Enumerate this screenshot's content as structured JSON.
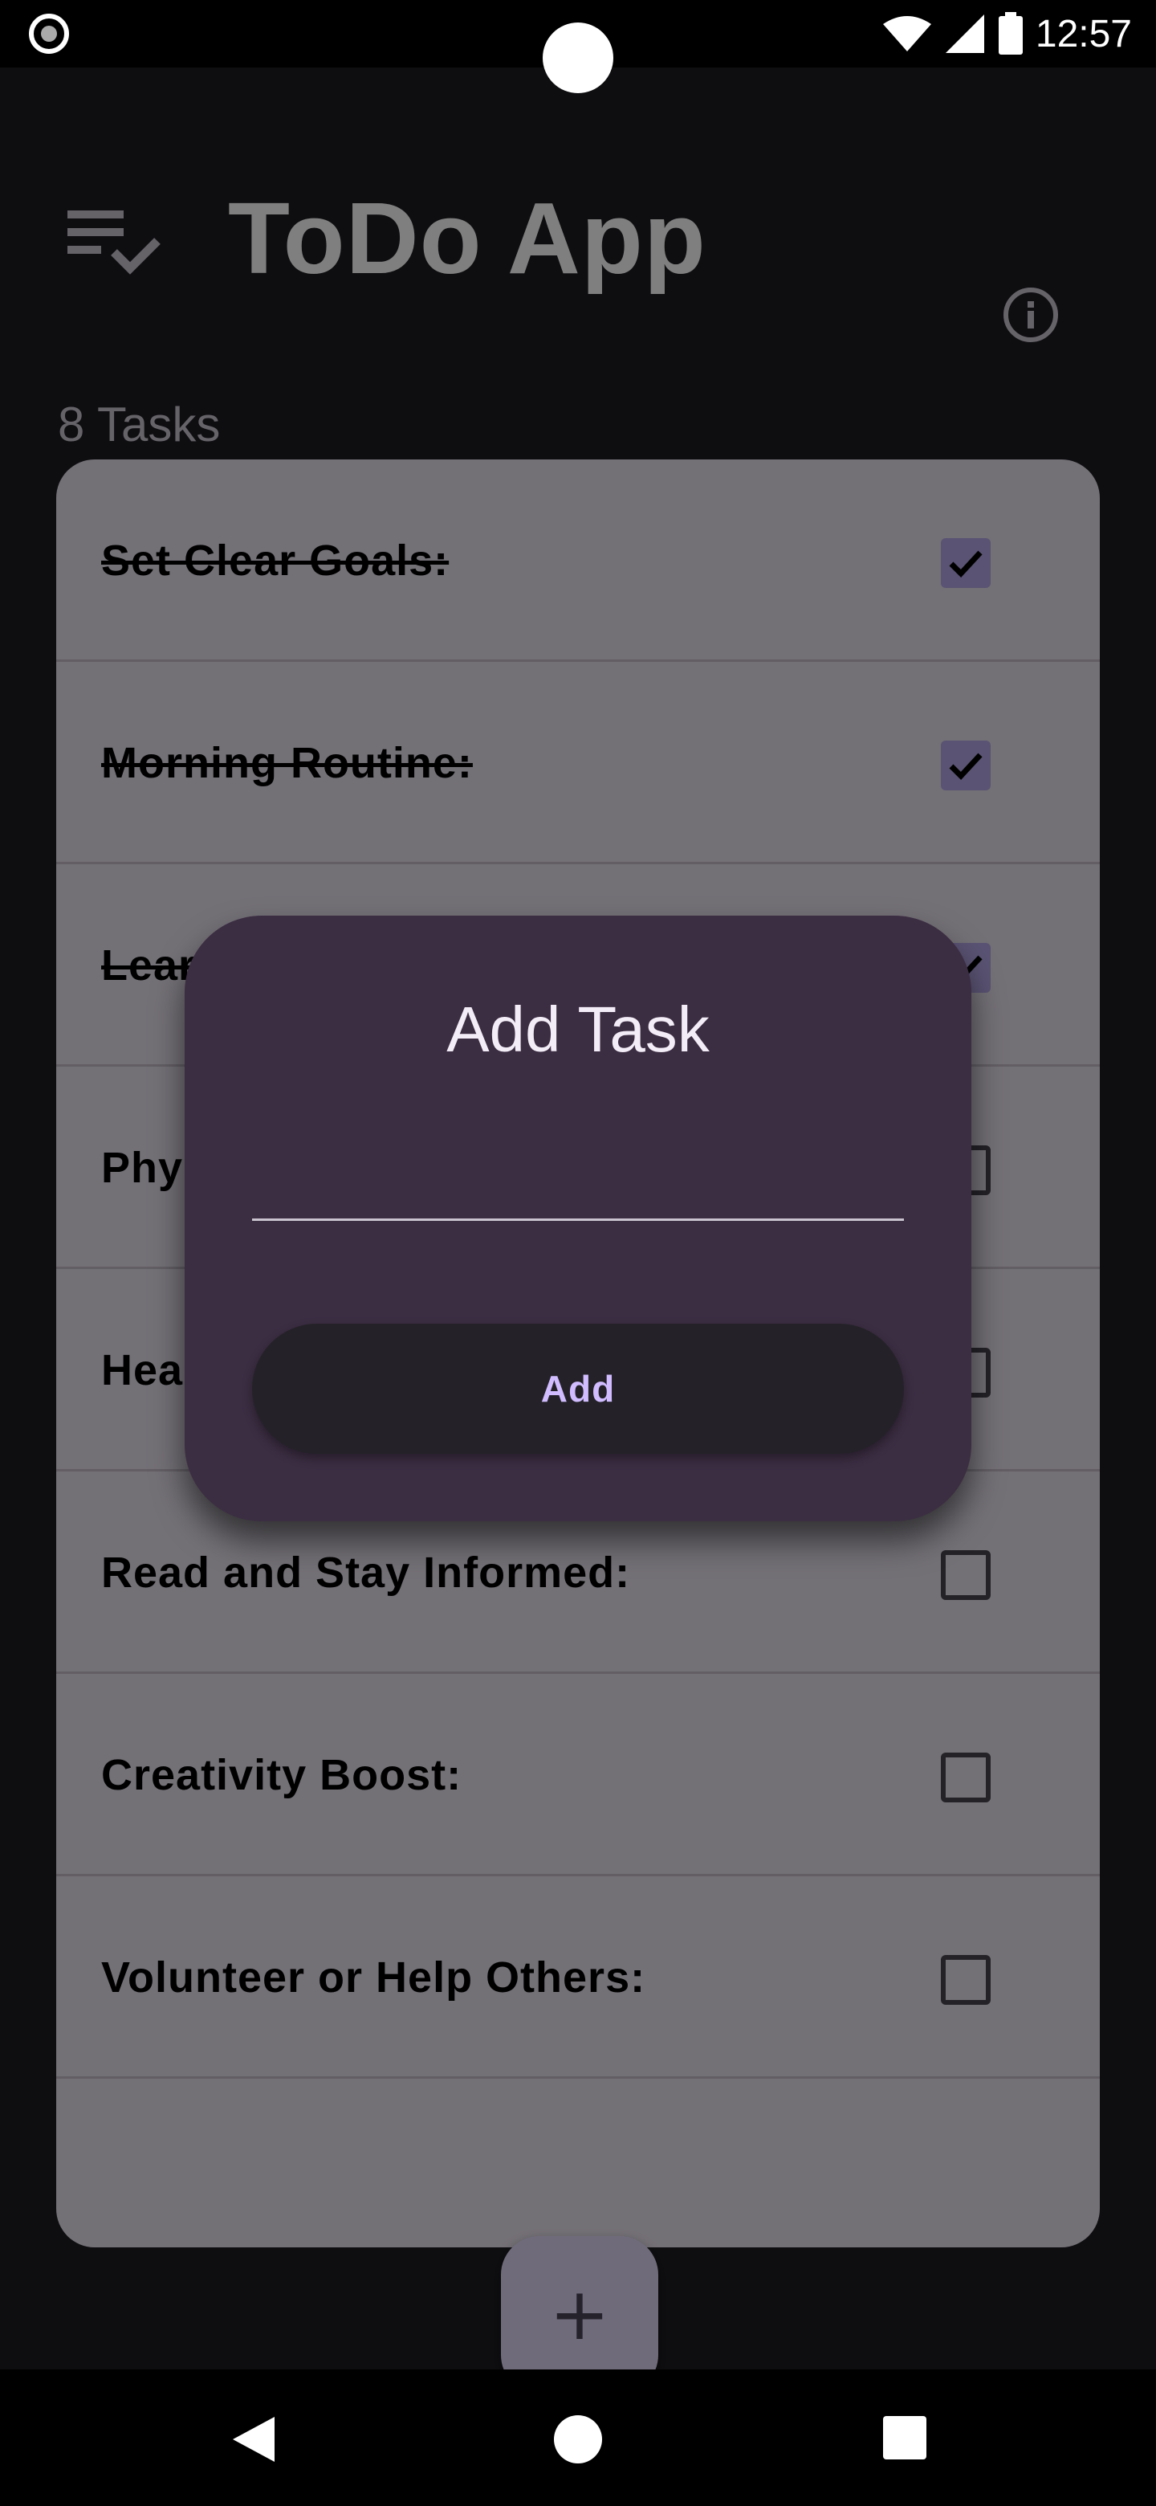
{
  "status_bar": {
    "time": "12:57"
  },
  "header": {
    "title": "ToDo App",
    "tasks_count": "8 Tasks",
    "menu_icon": "checklist-icon",
    "info_icon": "info-icon"
  },
  "tasks": [
    {
      "label": "Set Clear Goals:",
      "done": true
    },
    {
      "label": "Morning Routine:",
      "done": true
    },
    {
      "label": "Learn Something New:",
      "done": true
    },
    {
      "label": "Physical Exercise:",
      "done": false
    },
    {
      "label": "Healthy Eating:",
      "done": false
    },
    {
      "label": "Read and Stay Informed:",
      "done": false
    },
    {
      "label": "Creativity Boost:",
      "done": false
    },
    {
      "label": "Volunteer or Help Others:",
      "done": false
    }
  ],
  "fab": {
    "icon": "plus-icon",
    "symbol": "+"
  },
  "dialog": {
    "title": "Add Task",
    "input_value": "",
    "add_label": "Add"
  },
  "colors": {
    "background": "#1d1b20",
    "card": "#e7e0ec",
    "dialog": "#3b2d42",
    "accent": "#d0bcff",
    "checkbox_checked": "#b4a7e6"
  }
}
